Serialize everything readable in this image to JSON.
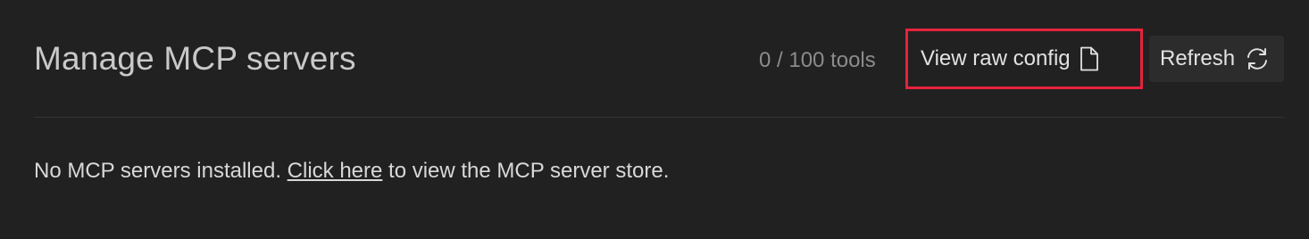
{
  "header": {
    "title": "Manage MCP servers",
    "tool_count": "0 / 100 tools",
    "view_raw_config_label": "View raw config",
    "refresh_label": "Refresh"
  },
  "icons": {
    "file": "file-icon",
    "refresh": "refresh-icon"
  },
  "empty_state": {
    "prefix": "No MCP servers installed. ",
    "link_label": "Click here",
    "suffix": " to view the MCP server store."
  },
  "colors": {
    "background": "#212121",
    "highlight_border": "#e5233d",
    "button_background": "#2c2c2c"
  }
}
